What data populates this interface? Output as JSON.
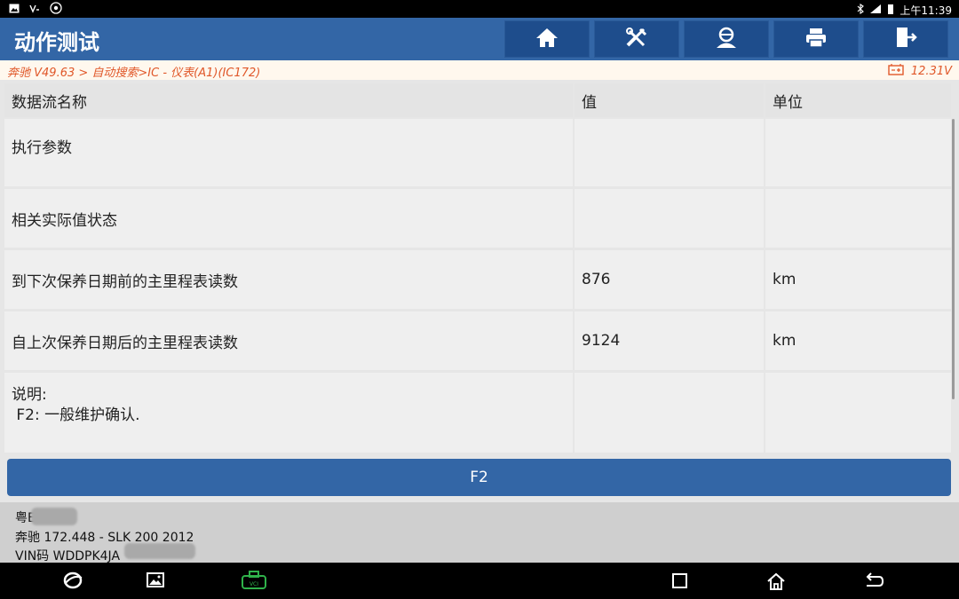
{
  "status_bar": {
    "time": "上午11:39",
    "icons": [
      "image-icon",
      "voicemail-icon",
      "android-icon",
      "bluetooth-icon",
      "signal-icon",
      "battery-icon"
    ]
  },
  "header": {
    "title": "动作测试",
    "buttons": [
      "home-icon",
      "diagnostic-tool-icon",
      "technician-icon",
      "print-icon",
      "exit-icon"
    ],
    "color": "#3366a6"
  },
  "breadcrumb": {
    "path": "奔驰 V49.63 > 自动搜索>IC - 仪表(A1)(IC172)",
    "voltage": "12.31V",
    "color": "#e0582a"
  },
  "table": {
    "headers": [
      "数据流名称",
      "值",
      "单位"
    ],
    "rows": [
      {
        "name": "执行参数",
        "value": "",
        "unit": ""
      },
      {
        "name": "相关实际值状态",
        "value": "",
        "unit": ""
      },
      {
        "name": "到下次保养日期前的主里程表读数",
        "value": "876",
        "unit": "km"
      },
      {
        "name": "自上次保养日期后的主里程表读数",
        "value": "9124",
        "unit": "km"
      }
    ],
    "note_line1": "说明:",
    "note_line2": " F2: 一般维护确认."
  },
  "actions": {
    "f2_label": "F2"
  },
  "vehicle_info": {
    "plate": "粤E",
    "model": "奔驰 172.448 - SLK 200 2012",
    "vin": "VIN码 WDDPK4JA"
  },
  "nav_bar": {
    "icons": [
      "browser-icon",
      "gallery-icon",
      "vci-icon",
      "recent-apps-icon",
      "home-nav-icon",
      "back-icon"
    ],
    "vci_label": "VCI"
  }
}
